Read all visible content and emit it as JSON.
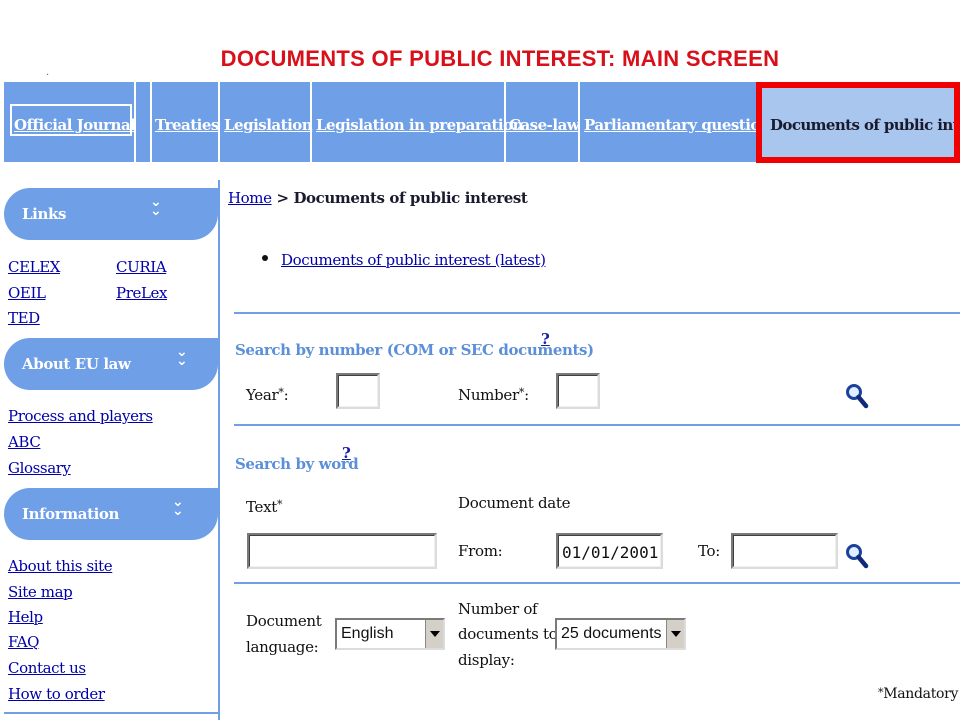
{
  "slide_title": "DOCUMENTS OF PUBLIC INTEREST:  MAIN SCREEN",
  "nav": {
    "items": [
      {
        "label": "Official Journal"
      },
      {
        "label": "Treaties"
      },
      {
        "label": "Legislation"
      },
      {
        "label": "Legislation in preparation"
      },
      {
        "label": "Case-law"
      },
      {
        "label": "Parliamentary questions"
      }
    ],
    "active_label": "Documents of public interes"
  },
  "sidebar": {
    "links_header": "Links",
    "links": [
      "CELEX",
      "CURIA",
      "OEIL",
      "PreLex",
      "TED"
    ],
    "about_header": "About EU law",
    "about_links": [
      "Process and players",
      "ABC",
      "Glossary"
    ],
    "info_header": "Information",
    "info_links": [
      "About this site",
      "Site map",
      "Help",
      "FAQ",
      "Contact us",
      "How to order"
    ]
  },
  "breadcrumb": {
    "home": "Home",
    "separator": " > ",
    "current": "Documents of public interest"
  },
  "latest_link": "Documents of public interest (latest)",
  "search_number": {
    "title": "Search by number (COM or SEC documents)",
    "help": "?",
    "year_label": "Year",
    "number_label": "Number",
    "required_mark": "*",
    "colon": ":"
  },
  "search_word": {
    "title": "Search by word",
    "help": "?",
    "text_label": "Text",
    "date_heading": "Document date",
    "from_label": "From:",
    "from_value": "01/01/2001",
    "to_label": "To:",
    "to_value": ""
  },
  "options": {
    "language_label_1": "Document",
    "language_label_2": "language:",
    "language_value": "English",
    "count_label_1": "Number of",
    "count_label_2": "documents to",
    "count_label_3": "display:",
    "count_value": "25 documents"
  },
  "mandatory_note": "Mandatory",
  "colors": {
    "nav_blue": "#6f9fe6",
    "active_tab": "#a9c6ee",
    "highlight_red": "#f00000",
    "title_red": "#d8101a",
    "link_blue": "#0000aa"
  },
  "icons": [
    "chevron-double-down-icon",
    "search-icon"
  ]
}
